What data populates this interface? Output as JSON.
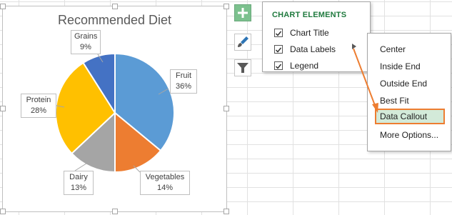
{
  "chart": {
    "title": "Recommended Diet"
  },
  "chart_data": {
    "type": "pie",
    "title": "Recommended Diet",
    "categories": [
      "Fruit",
      "Vegetables",
      "Dairy",
      "Protein",
      "Grains"
    ],
    "values": [
      36,
      14,
      13,
      28,
      9
    ],
    "colors": [
      "#5b9bd5",
      "#ed7d31",
      "#a5a5a5",
      "#ffc000",
      "#4472c4"
    ],
    "labels": [
      {
        "name": "Fruit",
        "value": "36%"
      },
      {
        "name": "Vegetables",
        "value": "14%"
      },
      {
        "name": "Dairy",
        "value": "13%"
      },
      {
        "name": "Protein",
        "value": "28%"
      },
      {
        "name": "Grains",
        "value": "9%"
      }
    ]
  },
  "side_buttons": [
    {
      "icon": "plus-icon",
      "active": true
    },
    {
      "icon": "paintbrush-icon",
      "active": false
    },
    {
      "icon": "filter-icon",
      "active": false
    }
  ],
  "flyout": {
    "title": "CHART ELEMENTS",
    "items": [
      {
        "label": "Chart Title",
        "checked": true
      },
      {
        "label": "Data Labels",
        "checked": true
      },
      {
        "label": "Legend",
        "checked": true
      }
    ]
  },
  "submenu": {
    "items": [
      "Center",
      "Inside End",
      "Outside End",
      "Best Fit",
      "Data Callout",
      "More Options..."
    ],
    "highlighted": "Data Callout"
  },
  "accent_color": "#ed7d31"
}
